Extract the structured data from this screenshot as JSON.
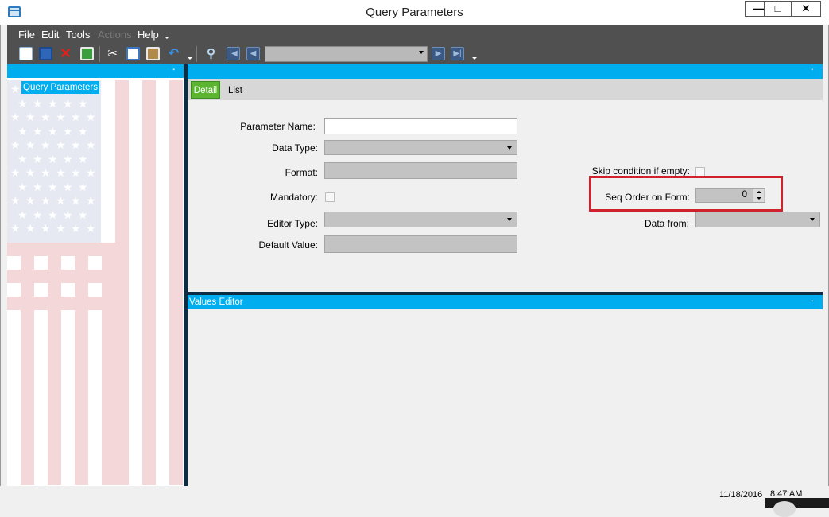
{
  "window": {
    "title": "Query Parameters",
    "buttons": {
      "minimize": "—",
      "maximize": "□",
      "close": "✕"
    }
  },
  "menu": {
    "items": [
      "File",
      "Edit",
      "Tools",
      "Actions",
      "Help"
    ],
    "disabled": [
      "Actions"
    ]
  },
  "toolbar": {
    "icons": [
      "new-document-icon",
      "save-icon",
      "delete-icon",
      "refresh-icon",
      "cut-icon",
      "copy-icon",
      "paste-icon",
      "undo-icon",
      "find-icon",
      "first-record-icon",
      "previous-record-icon",
      "next-record-icon",
      "last-record-icon"
    ],
    "nav_combo_value": ""
  },
  "left_panel": {
    "tab_label": "Query Parameters"
  },
  "detail": {
    "tabs": [
      "Detail",
      "List"
    ],
    "active_tab": "Detail",
    "fields": {
      "parameter_name": {
        "label": "Parameter Name:",
        "value": ""
      },
      "data_type": {
        "label": "Data Type:",
        "value": ""
      },
      "format": {
        "label": "Format:",
        "value": ""
      },
      "mandatory": {
        "label": "Mandatory:",
        "checked": false
      },
      "editor_type": {
        "label": "Editor Type:",
        "value": ""
      },
      "default_value": {
        "label": "Default Value:",
        "value": ""
      },
      "skip_condition": {
        "label": "Skip condition if empty:",
        "checked": false
      },
      "seq_order": {
        "label": "Seq Order on Form:",
        "value": "0"
      },
      "data_from": {
        "label": "Data from:",
        "value": ""
      }
    },
    "highlight_color": "#d0222d"
  },
  "values_editor": {
    "title": "Values Editor"
  },
  "statusbar": {
    "date": "11/18/2016",
    "time": "8:47 AM"
  },
  "colors": {
    "accent": "#00adef",
    "menu_band": "#505050",
    "active_tab": "#5cb531"
  }
}
